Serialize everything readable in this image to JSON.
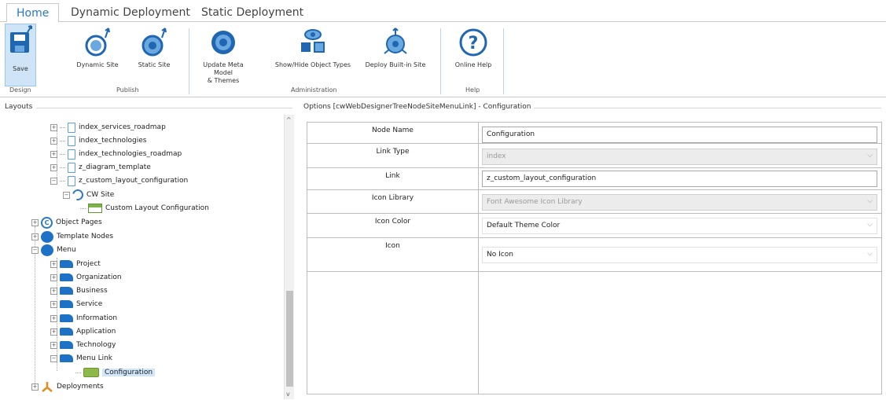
{
  "tabs": [
    {
      "label": "Home",
      "active": true
    },
    {
      "label": "Dynamic Deployment",
      "active": false
    },
    {
      "label": "Static Deployment",
      "active": false
    }
  ],
  "ribbon": {
    "save": "Save",
    "dynamic_site": "Dynamic Site",
    "static_site": "Static Site",
    "update_meta_model_1": "Update Meta Model",
    "update_meta_model_2": "& Themes",
    "show_hide_object_types": "Show/Hide Object Types",
    "deploy_built_in_site": "Deploy Built-in Site",
    "online_help": "Online Help",
    "groups": {
      "design": "Design",
      "publish": "Publish",
      "administration": "Administration",
      "help": "Help"
    }
  },
  "layouts": {
    "title": "Layouts",
    "tree": [
      "index_services_roadmap",
      "index_technologies",
      "index_technologies_roadmap",
      "z_diagram_template",
      "z_custom_layout_configuration",
      "CW Site",
      "Custom Layout Configuration",
      "Object Pages",
      "Template Nodes",
      "Menu",
      "Project",
      "Organization",
      "Business",
      "Service",
      "Information",
      "Application",
      "Technology",
      "Menu Link",
      "Configuration",
      "Deployments"
    ]
  },
  "options": {
    "title": "Options [cwWebDesignerTreeNodeSiteMenuLink] - Configuration",
    "rows": [
      {
        "label": "Node Name",
        "value": "Configuration"
      },
      {
        "label": "Link Type",
        "value": "index"
      },
      {
        "label": "Link",
        "value": "z_custom_layout_configuration"
      },
      {
        "label": "Icon Library",
        "value": "Font Awesome Icon Library"
      },
      {
        "label": "Icon Color",
        "value": "Default Theme Color"
      },
      {
        "label": "Icon",
        "value": "No Icon"
      }
    ]
  },
  "colors": {
    "accent": "#2b78c5",
    "selection": "#cfe6fb",
    "save_highlight": "#cfe4f7",
    "folder_blue": "#1e72c6"
  }
}
